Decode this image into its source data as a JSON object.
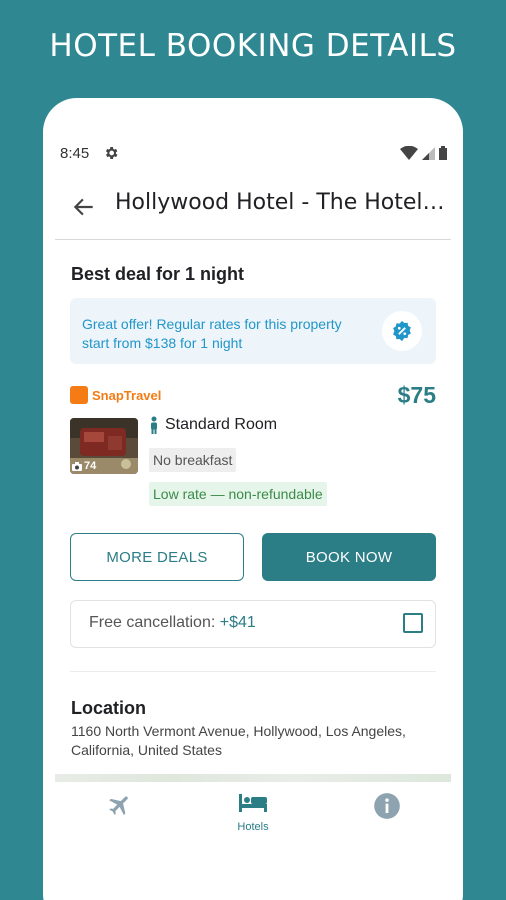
{
  "promo": {
    "title": "HOTEL BOOKING DETAILS"
  },
  "status_bar": {
    "time": "8:45"
  },
  "app_bar": {
    "title": "Hollywood Hotel - The Hotel of..."
  },
  "deal": {
    "heading": "Best deal for 1 night",
    "offer_text": "Great offer! Regular rates for this property start from $138 for 1 night",
    "provider": "SnapTravel",
    "price": "$75",
    "photo_count": "74",
    "room_name": "Standard Room",
    "tags": [
      "No breakfast",
      "Low rate — non-refundable"
    ]
  },
  "actions": {
    "more_deals": "MORE DEALS",
    "book_now": "BOOK NOW"
  },
  "cancellation": {
    "label": "Free cancellation: ",
    "price": "+$41",
    "checked": false
  },
  "location": {
    "heading": "Location",
    "address": "1160 North Vermont Avenue, Hollywood, Los Angeles, California, United States"
  },
  "bottom_nav": {
    "items": [
      {
        "icon": "airplane-icon",
        "label": ""
      },
      {
        "icon": "bed-icon",
        "label": "Hotels"
      },
      {
        "icon": "info-icon",
        "label": ""
      }
    ]
  },
  "colors": {
    "background": "#2e8791",
    "accent": "#2b7d86",
    "offer_text": "#2196c9",
    "provider": "#f57c14"
  }
}
